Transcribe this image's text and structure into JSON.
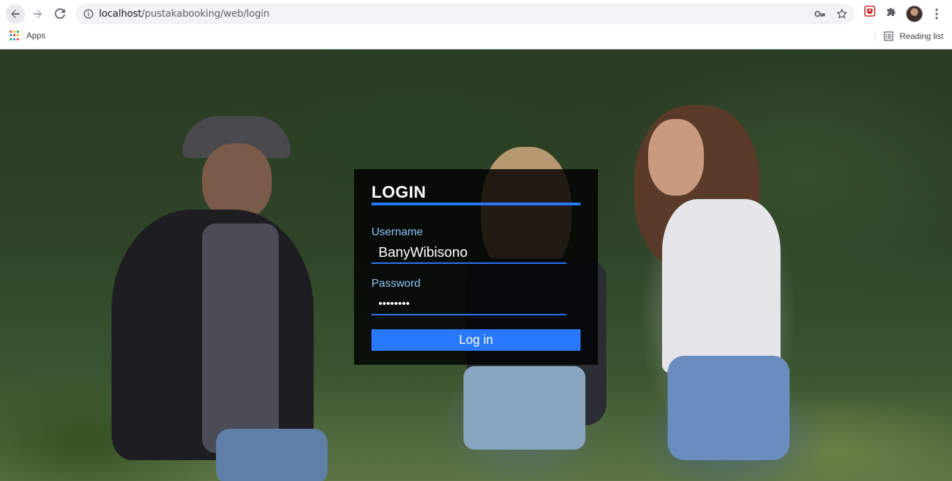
{
  "browser": {
    "url_host": "localhost",
    "url_path": "/pustakabooking/web/login",
    "bookmarks": {
      "apps_label": "Apps",
      "reading_list_label": "Reading list"
    },
    "icons": {
      "back": "back-arrow-icon",
      "forward": "forward-arrow-icon",
      "reload": "reload-icon",
      "info": "info-icon",
      "key": "key-icon",
      "star": "star-icon",
      "extension": "shield-extension-icon",
      "puzzle": "puzzle-icon",
      "menu": "menu-dots-icon"
    }
  },
  "login": {
    "title": "LOGIN",
    "username_label": "Username",
    "username_value": "BanyWibisono",
    "password_label": "Password",
    "password_value": "••••••••",
    "button_label": "Log in",
    "accent_color": "#2979ff",
    "label_color": "#8ec5ff"
  }
}
